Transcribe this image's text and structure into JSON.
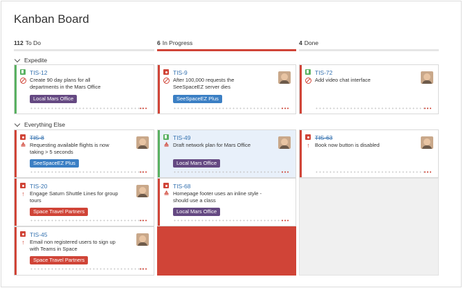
{
  "board": {
    "title": "Kanban Board"
  },
  "columns": [
    {
      "count": "112",
      "name": "To Do"
    },
    {
      "count": "6",
      "name": "In Progress"
    },
    {
      "count": "4",
      "name": "Done"
    }
  ],
  "swimlanes": [
    {
      "name": "Expedite"
    },
    {
      "name": "Everything Else"
    }
  ],
  "colors": {
    "accent_red": "#d04437",
    "story_green": "#59b161",
    "link_blue": "#3572b0",
    "epic_purple": "#654982",
    "epic_blue": "#3b7fc4",
    "epic_red": "#d04437"
  },
  "cards": [
    {
      "key": "TIS-12",
      "summary": "Create 90 day plans for all departments in the Mars Office",
      "type": "story-icon",
      "priority": "blocker-icon",
      "epic": "Local Mars Office",
      "avatar": false,
      "done": false
    },
    {
      "key": "TIS-9",
      "summary": "After 100,000 requests the SeeSpaceEZ server dies",
      "type": "bug-icon",
      "priority": "blocker-icon",
      "epic": "SeeSpaceEZ Plus",
      "avatar": true,
      "done": false
    },
    {
      "key": "TIS-72",
      "summary": "Add video chat interface",
      "type": "story-icon",
      "priority": "blocker-icon",
      "epic": "",
      "avatar": true,
      "done": false
    },
    {
      "key": "TIS-8",
      "summary": "Requesting available flights is now taking > 5 seconds",
      "type": "bug-icon",
      "priority": "critical-icon",
      "epic": "SeeSpaceEZ Plus",
      "avatar": true,
      "done": true
    },
    {
      "key": "TIS-49",
      "summary": "Draft network plan for Mars Office",
      "type": "story-icon",
      "priority": "critical-icon",
      "epic": "Local Mars Office",
      "avatar": true,
      "done": false
    },
    {
      "key": "TIS-63",
      "summary": "Book now button is disabled",
      "type": "bug-icon",
      "priority": "major-icon",
      "epic": "",
      "avatar": true,
      "done": true
    },
    {
      "key": "TIS-20",
      "summary": "Engage Saturn Shuttle Lines for group tours",
      "type": "bug-icon",
      "priority": "major-icon",
      "epic": "Space Travel Partners",
      "avatar": true,
      "done": false
    },
    {
      "key": "TIS-68",
      "summary": "Homepage footer uses an inline style - should use a class",
      "type": "bug-icon",
      "priority": "critical-icon",
      "epic": "Local Mars Office",
      "avatar": false,
      "done": false
    },
    {
      "key": "TIS-45",
      "summary": "Email non registered users to sign up with Teams in Space",
      "type": "story-icon",
      "priority": "major-icon",
      "epic": "Space Travel Partners",
      "avatar": true,
      "done": false
    }
  ]
}
